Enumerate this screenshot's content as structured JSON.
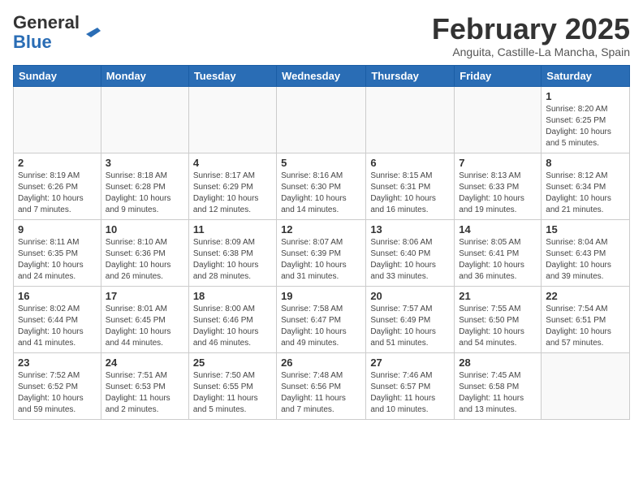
{
  "header": {
    "logo_general": "General",
    "logo_blue": "Blue",
    "month_title": "February 2025",
    "location": "Anguita, Castille-La Mancha, Spain"
  },
  "days_of_week": [
    "Sunday",
    "Monday",
    "Tuesday",
    "Wednesday",
    "Thursday",
    "Friday",
    "Saturday"
  ],
  "weeks": [
    [
      {
        "day": "",
        "info": ""
      },
      {
        "day": "",
        "info": ""
      },
      {
        "day": "",
        "info": ""
      },
      {
        "day": "",
        "info": ""
      },
      {
        "day": "",
        "info": ""
      },
      {
        "day": "",
        "info": ""
      },
      {
        "day": "1",
        "info": "Sunrise: 8:20 AM\nSunset: 6:25 PM\nDaylight: 10 hours\nand 5 minutes."
      }
    ],
    [
      {
        "day": "2",
        "info": "Sunrise: 8:19 AM\nSunset: 6:26 PM\nDaylight: 10 hours\nand 7 minutes."
      },
      {
        "day": "3",
        "info": "Sunrise: 8:18 AM\nSunset: 6:28 PM\nDaylight: 10 hours\nand 9 minutes."
      },
      {
        "day": "4",
        "info": "Sunrise: 8:17 AM\nSunset: 6:29 PM\nDaylight: 10 hours\nand 12 minutes."
      },
      {
        "day": "5",
        "info": "Sunrise: 8:16 AM\nSunset: 6:30 PM\nDaylight: 10 hours\nand 14 minutes."
      },
      {
        "day": "6",
        "info": "Sunrise: 8:15 AM\nSunset: 6:31 PM\nDaylight: 10 hours\nand 16 minutes."
      },
      {
        "day": "7",
        "info": "Sunrise: 8:13 AM\nSunset: 6:33 PM\nDaylight: 10 hours\nand 19 minutes."
      },
      {
        "day": "8",
        "info": "Sunrise: 8:12 AM\nSunset: 6:34 PM\nDaylight: 10 hours\nand 21 minutes."
      }
    ],
    [
      {
        "day": "9",
        "info": "Sunrise: 8:11 AM\nSunset: 6:35 PM\nDaylight: 10 hours\nand 24 minutes."
      },
      {
        "day": "10",
        "info": "Sunrise: 8:10 AM\nSunset: 6:36 PM\nDaylight: 10 hours\nand 26 minutes."
      },
      {
        "day": "11",
        "info": "Sunrise: 8:09 AM\nSunset: 6:38 PM\nDaylight: 10 hours\nand 28 minutes."
      },
      {
        "day": "12",
        "info": "Sunrise: 8:07 AM\nSunset: 6:39 PM\nDaylight: 10 hours\nand 31 minutes."
      },
      {
        "day": "13",
        "info": "Sunrise: 8:06 AM\nSunset: 6:40 PM\nDaylight: 10 hours\nand 33 minutes."
      },
      {
        "day": "14",
        "info": "Sunrise: 8:05 AM\nSunset: 6:41 PM\nDaylight: 10 hours\nand 36 minutes."
      },
      {
        "day": "15",
        "info": "Sunrise: 8:04 AM\nSunset: 6:43 PM\nDaylight: 10 hours\nand 39 minutes."
      }
    ],
    [
      {
        "day": "16",
        "info": "Sunrise: 8:02 AM\nSunset: 6:44 PM\nDaylight: 10 hours\nand 41 minutes."
      },
      {
        "day": "17",
        "info": "Sunrise: 8:01 AM\nSunset: 6:45 PM\nDaylight: 10 hours\nand 44 minutes."
      },
      {
        "day": "18",
        "info": "Sunrise: 8:00 AM\nSunset: 6:46 PM\nDaylight: 10 hours\nand 46 minutes."
      },
      {
        "day": "19",
        "info": "Sunrise: 7:58 AM\nSunset: 6:47 PM\nDaylight: 10 hours\nand 49 minutes."
      },
      {
        "day": "20",
        "info": "Sunrise: 7:57 AM\nSunset: 6:49 PM\nDaylight: 10 hours\nand 51 minutes."
      },
      {
        "day": "21",
        "info": "Sunrise: 7:55 AM\nSunset: 6:50 PM\nDaylight: 10 hours\nand 54 minutes."
      },
      {
        "day": "22",
        "info": "Sunrise: 7:54 AM\nSunset: 6:51 PM\nDaylight: 10 hours\nand 57 minutes."
      }
    ],
    [
      {
        "day": "23",
        "info": "Sunrise: 7:52 AM\nSunset: 6:52 PM\nDaylight: 10 hours\nand 59 minutes."
      },
      {
        "day": "24",
        "info": "Sunrise: 7:51 AM\nSunset: 6:53 PM\nDaylight: 11 hours\nand 2 minutes."
      },
      {
        "day": "25",
        "info": "Sunrise: 7:50 AM\nSunset: 6:55 PM\nDaylight: 11 hours\nand 5 minutes."
      },
      {
        "day": "26",
        "info": "Sunrise: 7:48 AM\nSunset: 6:56 PM\nDaylight: 11 hours\nand 7 minutes."
      },
      {
        "day": "27",
        "info": "Sunrise: 7:46 AM\nSunset: 6:57 PM\nDaylight: 11 hours\nand 10 minutes."
      },
      {
        "day": "28",
        "info": "Sunrise: 7:45 AM\nSunset: 6:58 PM\nDaylight: 11 hours\nand 13 minutes."
      },
      {
        "day": "",
        "info": ""
      }
    ]
  ]
}
